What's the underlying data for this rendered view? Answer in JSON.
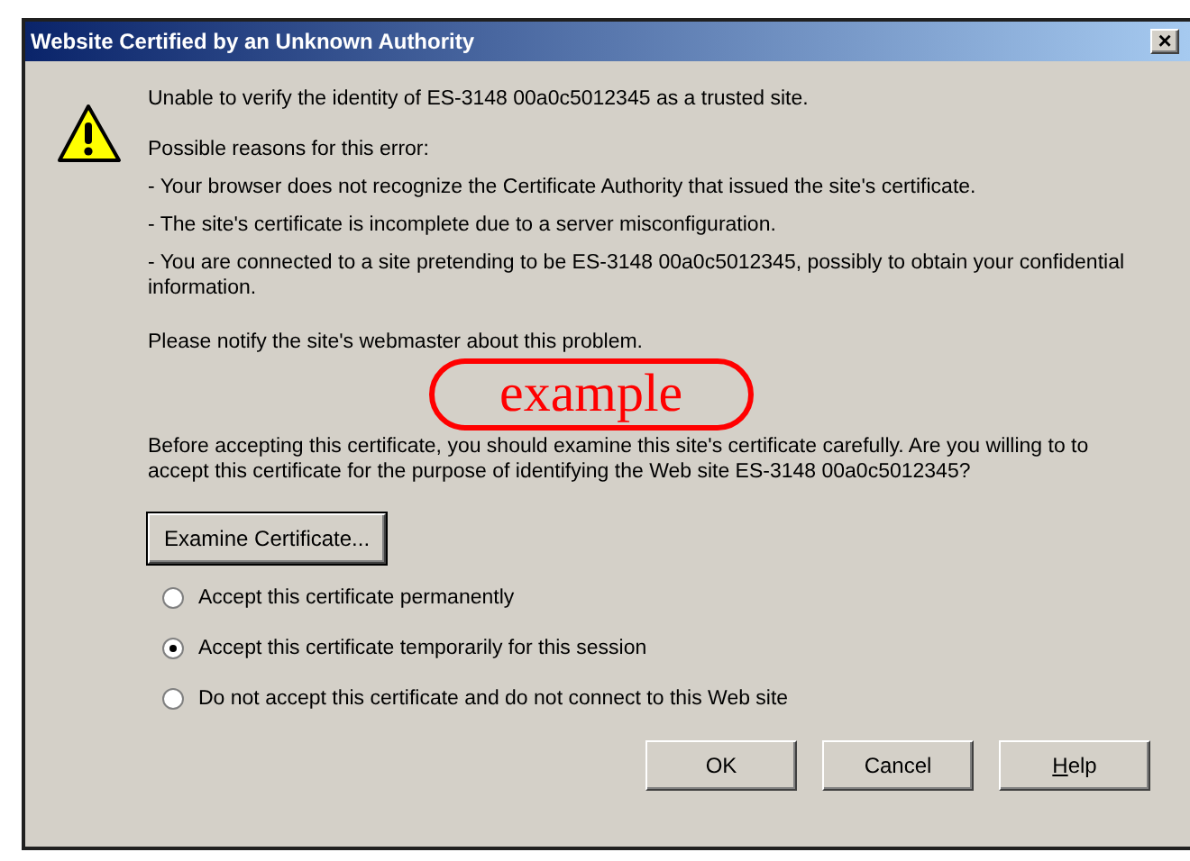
{
  "window": {
    "title": "Website Certified by an Unknown Authority",
    "close": "×"
  },
  "message": "Unable to verify the identity of ES-3148 00a0c5012345 as a trusted site.",
  "reasons_heading": "Possible reasons for this error:",
  "reasons": [
    "- Your browser does not recognize the Certificate Authority that issued the site's certificate.",
    "- The site's certificate is incomplete due to a server misconfiguration.",
    "- You are connected to a site pretending to be ES-3148 00a0c5012345, possibly to obtain your confidential information."
  ],
  "notify": "Please notify the site's webmaster about this problem.",
  "annotation": "example",
  "question": "Before accepting this certificate, you should examine this site's certificate carefully. Are you willing to to accept this certificate for the purpose of identifying the Web site ES-3148 00a0c5012345?",
  "examine_button": "Examine Certificate...",
  "options": [
    {
      "label": "Accept this certificate permanently",
      "selected": false
    },
    {
      "label": "Accept this certificate temporarily for this session",
      "selected": true
    },
    {
      "label": "Do not accept this certificate and do not connect to this Web site",
      "selected": false
    }
  ],
  "buttons": [
    {
      "label": "OK",
      "underline_first": false
    },
    {
      "label": "Cancel",
      "underline_first": false
    },
    {
      "label": "Help",
      "underline_first": true
    }
  ]
}
